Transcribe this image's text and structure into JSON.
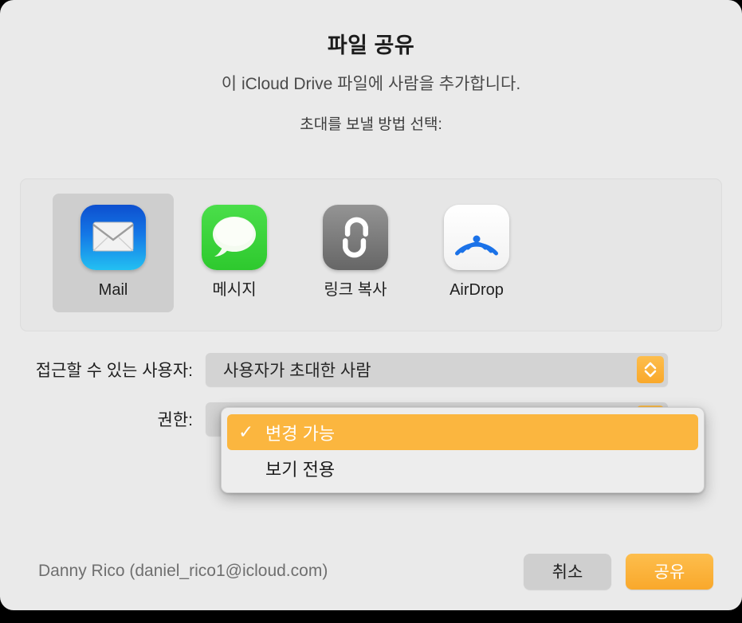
{
  "dialog": {
    "title": "파일 공유",
    "subtitle": "이 iCloud Drive 파일에 사람을 추가합니다.",
    "instruction": "초대를 보낼 방법 선택:"
  },
  "share_methods": [
    {
      "label": "Mail",
      "icon": "mail-icon",
      "selected": true
    },
    {
      "label": "메시지",
      "icon": "messages-icon",
      "selected": false
    },
    {
      "label": "링크 복사",
      "icon": "link-icon",
      "selected": false
    },
    {
      "label": "AirDrop",
      "icon": "airdrop-icon",
      "selected": false
    }
  ],
  "form": {
    "access_label": "접근할 수 있는 사용자:",
    "access_value": "사용자가 초대한 사람",
    "permission_label": "권한:",
    "permission_value": "변경 가능"
  },
  "popup_menu": {
    "items": [
      {
        "label": "변경 가능",
        "checked": true,
        "highlighted": true
      },
      {
        "label": "보기 전용",
        "checked": false,
        "highlighted": false
      }
    ],
    "check_glyph": "✓"
  },
  "footer": {
    "account": "Danny Rico (daniel_rico1@icloud.com)",
    "cancel_label": "취소",
    "share_label": "공유"
  },
  "colors": {
    "accent_orange": "#fbb63f",
    "dialog_background": "#eaeaea",
    "select_background": "#d3d3d3",
    "selected_item_background": "#cecece"
  }
}
